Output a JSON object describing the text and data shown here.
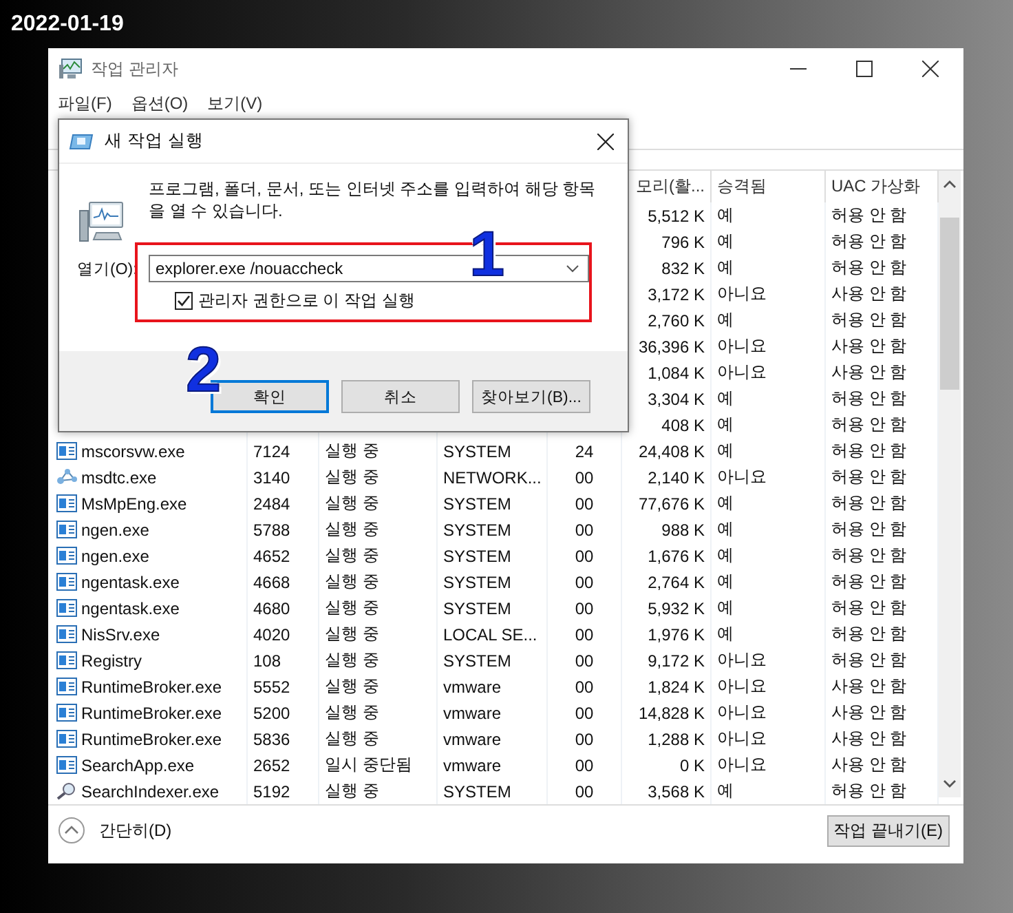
{
  "date_label": "2022-01-19",
  "window": {
    "title": "작업 관리자"
  },
  "menu": [
    "파일(F)",
    "옵션(O)",
    "보기(V)"
  ],
  "table": {
    "visible_headers": [
      "모리(활...",
      "승격됨",
      "UAC 가상화"
    ],
    "rows": [
      {
        "memory": "5,512 K",
        "elevated": "예",
        "uac": "허용 안 함"
      },
      {
        "memory": "796 K",
        "elevated": "예",
        "uac": "허용 안 함"
      },
      {
        "memory": "832 K",
        "elevated": "예",
        "uac": "허용 안 함"
      },
      {
        "memory": "3,172 K",
        "elevated": "아니요",
        "uac": "사용 안 함"
      },
      {
        "memory": "2,760 K",
        "elevated": "예",
        "uac": "허용 안 함"
      },
      {
        "memory": "36,396 K",
        "elevated": "아니요",
        "uac": "사용 안 함"
      },
      {
        "memory": "1,084 K",
        "elevated": "아니요",
        "uac": "사용 안 함"
      },
      {
        "memory": "3,304 K",
        "elevated": "예",
        "uac": "허용 안 함"
      },
      {
        "memory": "408 K",
        "elevated": "예",
        "uac": "허용 안 함"
      },
      {
        "kind": "app",
        "name": "mscorsvw.exe",
        "pid": "7124",
        "status": "실행 중",
        "user": "SYSTEM",
        "cpu": "24",
        "memory": "24,408 K",
        "elevated": "예",
        "uac": "허용 안 함"
      },
      {
        "kind": "service",
        "name": "msdtc.exe",
        "pid": "3140",
        "status": "실행 중",
        "user": "NETWORK...",
        "cpu": "00",
        "memory": "2,140 K",
        "elevated": "아니요",
        "uac": "허용 안 함"
      },
      {
        "kind": "app",
        "name": "MsMpEng.exe",
        "pid": "2484",
        "status": "실행 중",
        "user": "SYSTEM",
        "cpu": "00",
        "memory": "77,676 K",
        "elevated": "예",
        "uac": "허용 안 함"
      },
      {
        "kind": "app",
        "name": "ngen.exe",
        "pid": "5788",
        "status": "실행 중",
        "user": "SYSTEM",
        "cpu": "00",
        "memory": "988 K",
        "elevated": "예",
        "uac": "허용 안 함"
      },
      {
        "kind": "app",
        "name": "ngen.exe",
        "pid": "4652",
        "status": "실행 중",
        "user": "SYSTEM",
        "cpu": "00",
        "memory": "1,676 K",
        "elevated": "예",
        "uac": "허용 안 함"
      },
      {
        "kind": "app",
        "name": "ngentask.exe",
        "pid": "4668",
        "status": "실행 중",
        "user": "SYSTEM",
        "cpu": "00",
        "memory": "2,764 K",
        "elevated": "예",
        "uac": "허용 안 함"
      },
      {
        "kind": "app",
        "name": "ngentask.exe",
        "pid": "4680",
        "status": "실행 중",
        "user": "SYSTEM",
        "cpu": "00",
        "memory": "5,932 K",
        "elevated": "예",
        "uac": "허용 안 함"
      },
      {
        "kind": "app",
        "name": "NisSrv.exe",
        "pid": "4020",
        "status": "실행 중",
        "user": "LOCAL SE...",
        "cpu": "00",
        "memory": "1,976 K",
        "elevated": "예",
        "uac": "허용 안 함"
      },
      {
        "kind": "app",
        "name": "Registry",
        "pid": "108",
        "status": "실행 중",
        "user": "SYSTEM",
        "cpu": "00",
        "memory": "9,172 K",
        "elevated": "아니요",
        "uac": "허용 안 함"
      },
      {
        "kind": "app",
        "name": "RuntimeBroker.exe",
        "pid": "5552",
        "status": "실행 중",
        "user": "vmware",
        "cpu": "00",
        "memory": "1,824 K",
        "elevated": "아니요",
        "uac": "사용 안 함"
      },
      {
        "kind": "app",
        "name": "RuntimeBroker.exe",
        "pid": "5200",
        "status": "실행 중",
        "user": "vmware",
        "cpu": "00",
        "memory": "14,828 K",
        "elevated": "아니요",
        "uac": "사용 안 함"
      },
      {
        "kind": "app",
        "name": "RuntimeBroker.exe",
        "pid": "5836",
        "status": "실행 중",
        "user": "vmware",
        "cpu": "00",
        "memory": "1,288 K",
        "elevated": "아니요",
        "uac": "사용 안 함"
      },
      {
        "kind": "app",
        "name": "SearchApp.exe",
        "pid": "2652",
        "status": "일시 중단됨",
        "user": "vmware",
        "cpu": "00",
        "memory": "0 K",
        "elevated": "아니요",
        "uac": "사용 안 함"
      },
      {
        "kind": "search",
        "name": "SearchIndexer.exe",
        "pid": "5192",
        "status": "실행 중",
        "user": "SYSTEM",
        "cpu": "00",
        "memory": "3,568 K",
        "elevated": "예",
        "uac": "허용 안 함"
      }
    ]
  },
  "footer": {
    "toggle": "간단히(D)",
    "end_task": "작업 끝내기(E)"
  },
  "dialog": {
    "title": "새 작업 실행",
    "message": "프로그램, 폴더, 문서, 또는 인터넷 주소를 입력하여 해당 항목을 열 수 있습니다.",
    "open_label": "열기(O):",
    "open_value": "explorer.exe /nouaccheck",
    "admin_checkbox": {
      "label": "관리자 권한으로 이 작업 실행",
      "checked": true
    },
    "buttons": [
      {
        "label": "확인",
        "selected": true
      },
      {
        "label": "취소",
        "selected": false
      },
      {
        "label": "찾아보기(B)...",
        "selected": false
      }
    ]
  },
  "annotations": [
    "1",
    "2"
  ]
}
